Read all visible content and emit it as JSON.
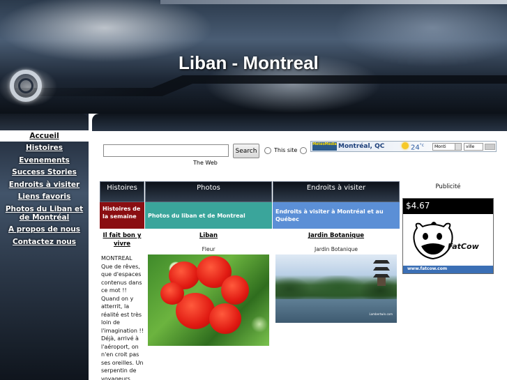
{
  "site": {
    "title": "Liban - Montreal"
  },
  "nav": {
    "items": [
      {
        "label": "Accueil"
      },
      {
        "label": "Histoires"
      },
      {
        "label": "Evenements"
      },
      {
        "label": "Success Stories"
      },
      {
        "label": "Endroits à visiter"
      },
      {
        "label": "Liens favoris"
      },
      {
        "label": "Photos du Liban et de Montréal"
      },
      {
        "label": "A propos de nous"
      },
      {
        "label": "Contactez nous"
      }
    ]
  },
  "search": {
    "button_label": "Search",
    "option_site": "This site",
    "option_web": "The Web"
  },
  "weather": {
    "logo_text": "MétéoMédia",
    "city": "Montréal, QC",
    "temperature": "24",
    "unit": "°c",
    "select_value": "Monti",
    "ville_placeholder": "ville"
  },
  "columns": {
    "histoires": {
      "header": "Histoires",
      "subheader": "Histoires de la semaine",
      "link": "Il fait bon y vivre",
      "story": "MONTREAL Que de rêves, que d'espaces contenus dans ce mot !! Quand on y atterrit, la réalité est très loin de l'imagination !! Déjà, arrivé à l'aéroport, on n'en croit pas ses oreilles. Un serpentin de voyageurs vous fait face, dans"
    },
    "photos": {
      "header": "Photos",
      "subheader": "Photos du liban et de Montreal",
      "link": "Liban",
      "caption": "Fleur"
    },
    "endroits": {
      "header": "Endroits à visiter",
      "subheader": "Endroits à visiter à Montréal et au Québec",
      "link": "Jardin Botanique",
      "caption": "Jardin Botanique",
      "watermark": "Lambertwin.com"
    }
  },
  "ad": {
    "label": "Publicité",
    "price": "$4.67",
    "brand": "FatCow",
    "url": "www.fatcow.com"
  }
}
